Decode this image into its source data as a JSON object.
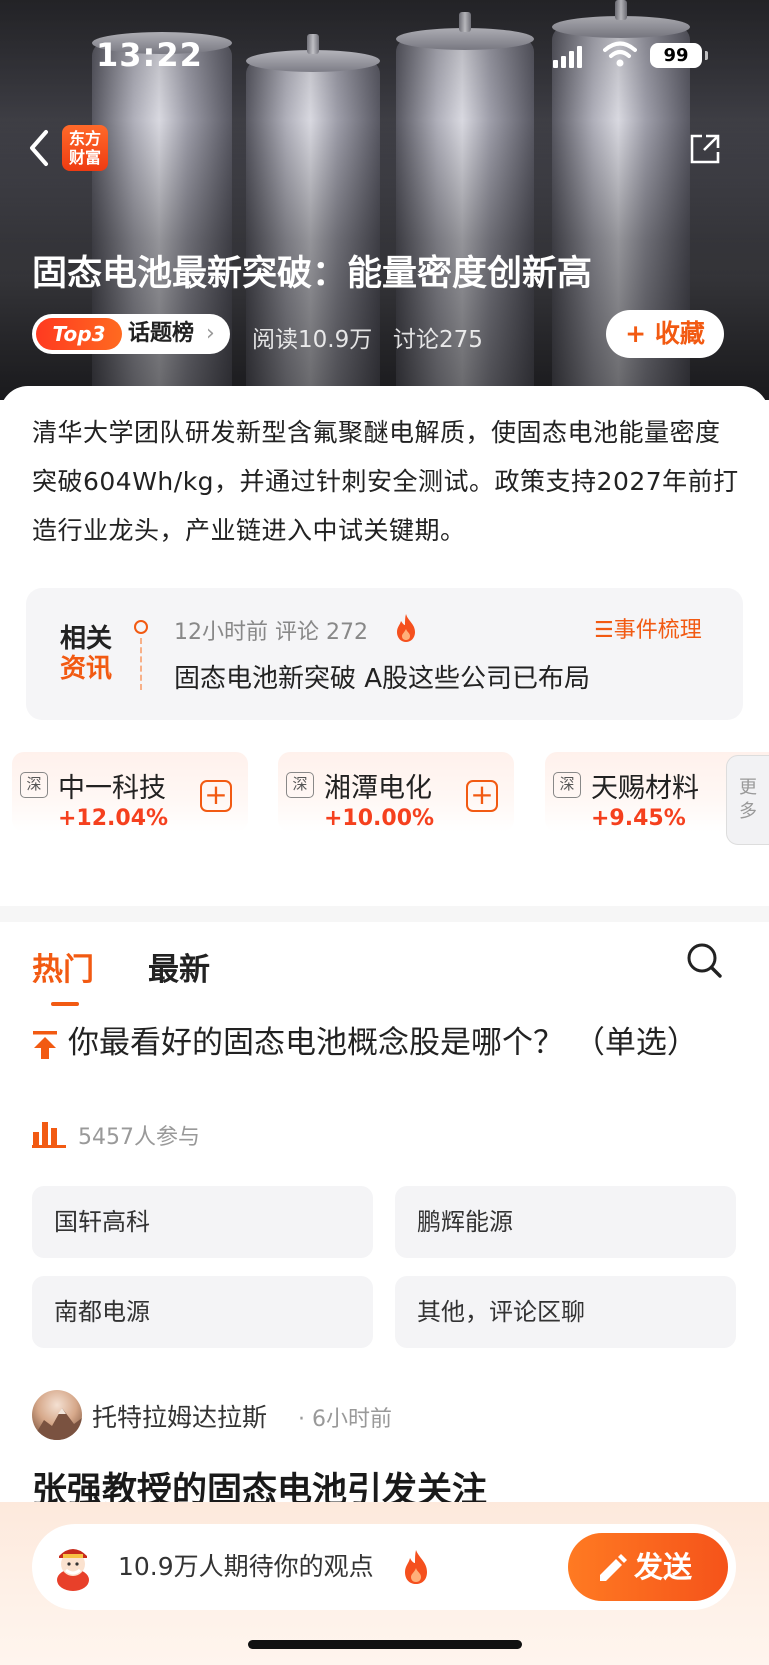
{
  "status_bar": {
    "time": "13:22",
    "battery": "99"
  },
  "header": {
    "logo_line1": "东方",
    "logo_line2": "财富",
    "title": "固态电池最新突破：能量密度创新高",
    "topic_badge": "Top3",
    "topic_label": "话题榜",
    "read_count": "阅读10.9万",
    "discuss_count": "讨论275",
    "favorite_label": "+ 收藏"
  },
  "summary": "清华大学团队研发新型含氟聚醚电解质，使固态电池能量密度突破604Wh/kg，并通过针刺安全测试。政策支持2027年前打造行业龙头，产业链进入中试关键期。",
  "related": {
    "label_line1": "相关",
    "label_line2": "资讯",
    "meta": "12小时前  评论  272",
    "event_link": "☰事件梳理",
    "headline": "固态电池新突破 A股这些公司已布局"
  },
  "stocks": [
    {
      "exchange": "深",
      "name": "中一科技",
      "change": "+12.04%"
    },
    {
      "exchange": "深",
      "name": "湘潭电化",
      "change": "+10.00%"
    },
    {
      "exchange": "深",
      "name": "天赐材料",
      "change": "+9.45%"
    }
  ],
  "more_label": "更多",
  "tabs": {
    "hot": "热门",
    "new": "最新"
  },
  "poll": {
    "question": "你最看好的固态电池概念股是哪个？  （单选）",
    "participants": "5457人参与",
    "options": [
      "国轩高科",
      "鹏辉能源",
      "南都电源",
      "其他，评论区聊"
    ]
  },
  "post": {
    "author": "托特拉姆达拉斯",
    "time": "· 6小时前",
    "title": "张强教授的固态电池引发关注"
  },
  "bottom": {
    "placeholder": "10.9万人期待你的观点",
    "send_label": "发送"
  },
  "colors": {
    "accent": "#f25a12",
    "up": "#f5401e"
  }
}
